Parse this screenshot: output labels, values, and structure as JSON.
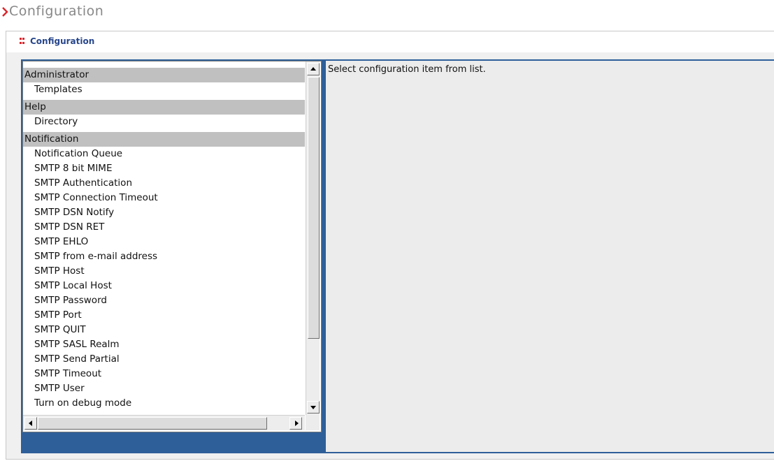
{
  "page": {
    "title": "Configuration"
  },
  "panel": {
    "title": "Configuration"
  },
  "config_list": {
    "groups": [
      {
        "label": "Administrator",
        "items": [
          "Templates"
        ]
      },
      {
        "label": "Help",
        "items": [
          "Directory"
        ]
      },
      {
        "label": "Notification",
        "items": [
          "Notification Queue",
          "SMTP 8 bit MIME",
          "SMTP Authentication",
          "SMTP Connection Timeout",
          "SMTP DSN Notify",
          "SMTP DSN RET",
          "SMTP EHLO",
          "SMTP from e-mail address",
          "SMTP Host",
          "SMTP Local Host",
          "SMTP Password",
          "SMTP Port",
          "SMTP QUIT",
          "SMTP SASL Realm",
          "SMTP Send Partial",
          "SMTP Timeout",
          "SMTP User",
          "Turn on debug mode"
        ]
      }
    ]
  },
  "detail": {
    "message": "Select configuration item from list."
  },
  "colors": {
    "accent": "#2e5f99",
    "group_header_bg": "#c0c0c0",
    "panel_title": "#27468b",
    "chevron": "#d9262c"
  }
}
